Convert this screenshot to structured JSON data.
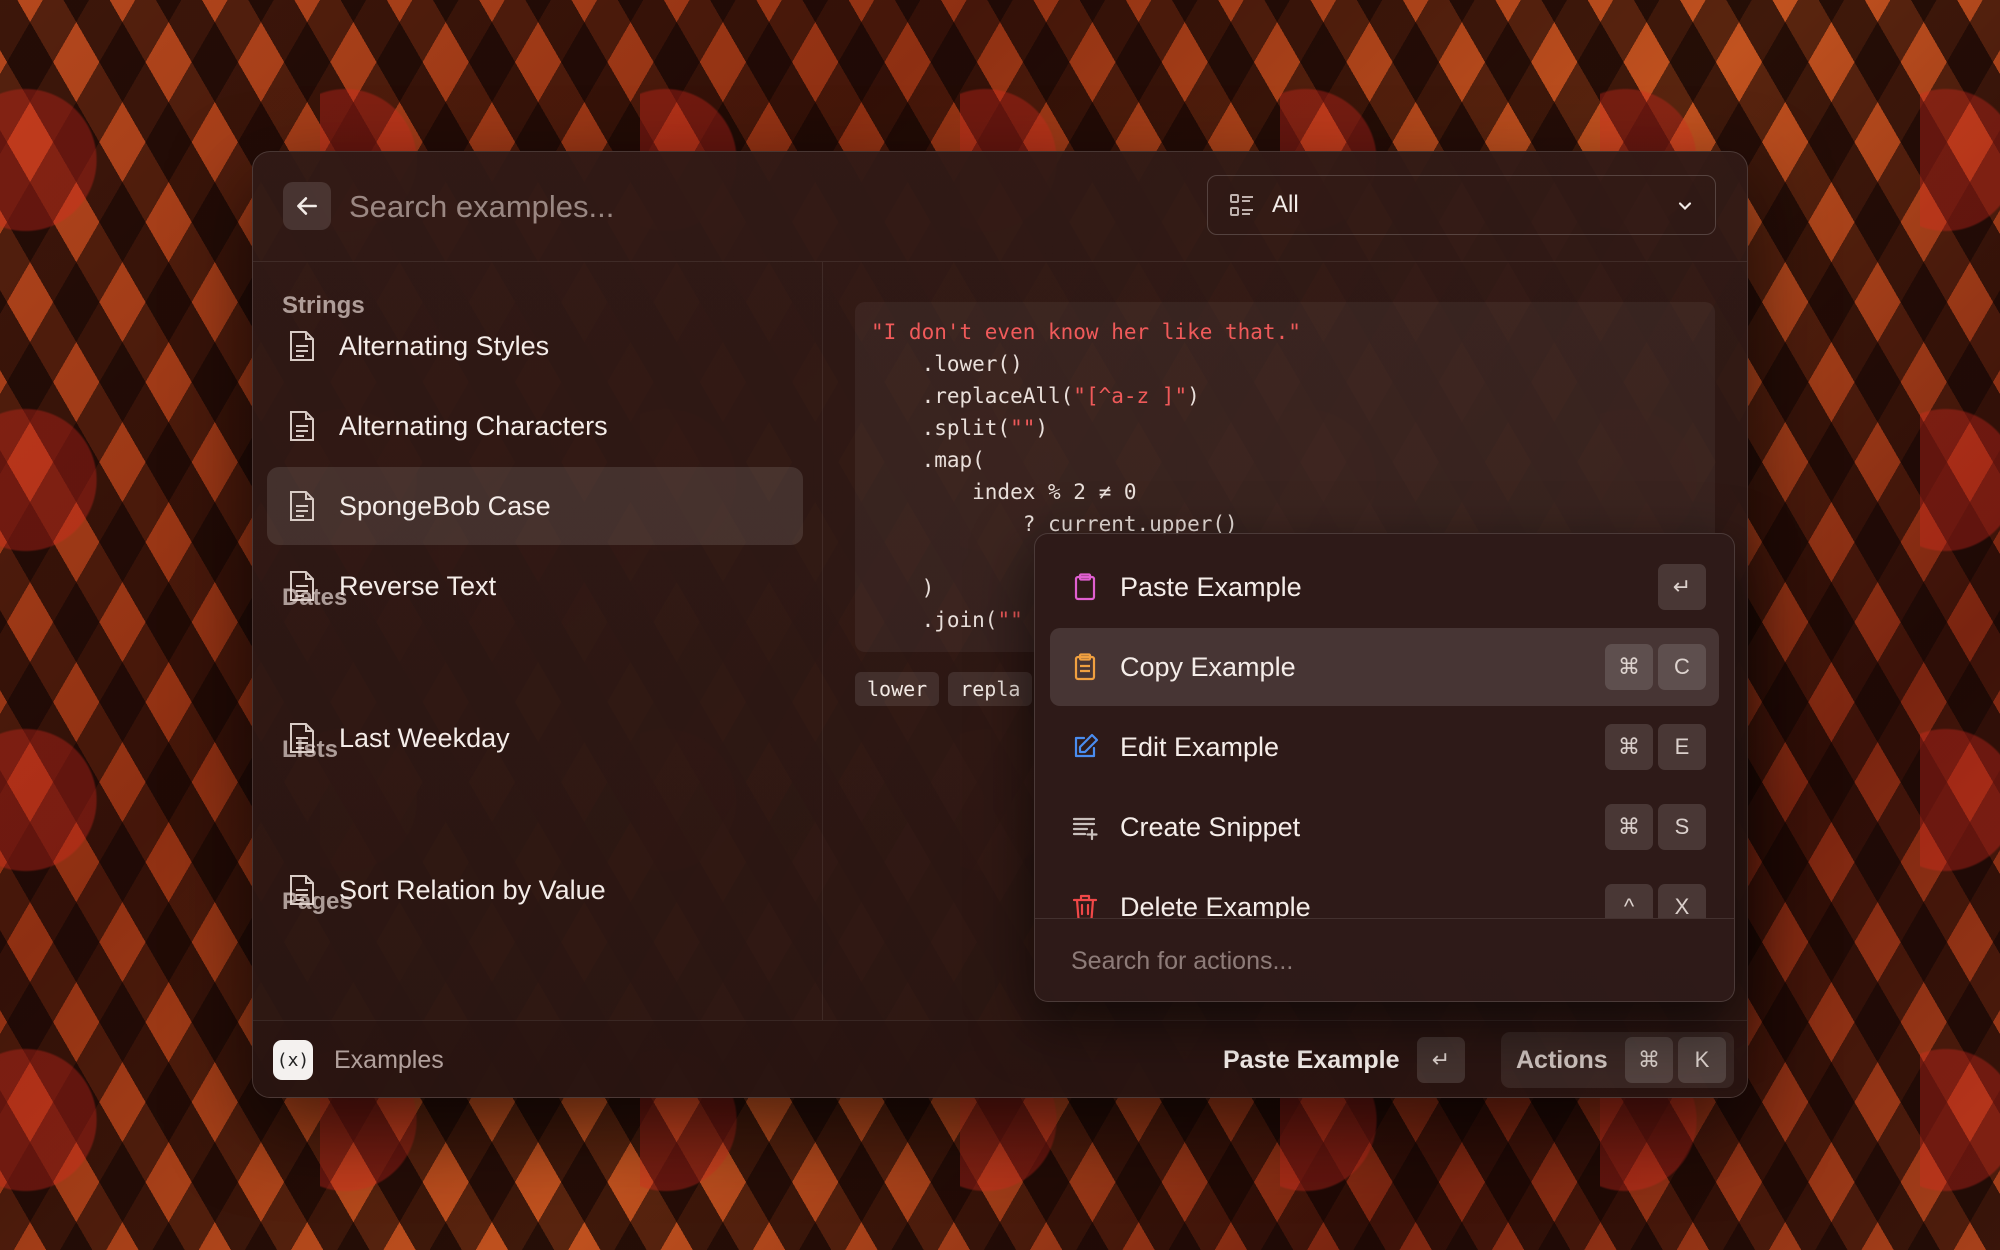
{
  "search": {
    "placeholder": "Search examples..."
  },
  "filter": {
    "value": "All"
  },
  "sidebar": {
    "sections": [
      {
        "title": "Strings",
        "items": [
          "Alternating Styles",
          "Alternating Characters",
          "SpongeBob Case",
          "Reverse Text"
        ]
      },
      {
        "title": "Dates",
        "items": [
          "Last Weekday"
        ]
      },
      {
        "title": "Lists",
        "items": [
          "Sort Relation by Value"
        ]
      },
      {
        "title": "Pages",
        "items": []
      }
    ],
    "selected": "SpongeBob Case"
  },
  "code": {
    "line1": "\"I don't even know her like that.\"",
    "line2": "    .lower()",
    "line3a": "    .replaceAll(",
    "line3b": "\"[^a-z ]\"",
    "line3c": ")",
    "line4a": "    .split(",
    "line4b": "\"\"",
    "line4c": ")",
    "line5": "    .map(",
    "line6": "        index % 2 ≠ 0",
    "line7": "            ? current.upper()",
    "line8": "",
    "line9": "    )",
    "line10a": "    .join(",
    "line10b": "\"\""
  },
  "tags": [
    "lower",
    "repla"
  ],
  "actions_menu": {
    "items": [
      {
        "label": "Paste Example",
        "keys": [
          "↵"
        ],
        "icon": "clipboard-icon",
        "color": "#e05fd0"
      },
      {
        "label": "Copy Example",
        "keys": [
          "⌘",
          "C"
        ],
        "icon": "clipboard-list-icon",
        "color": "#f0a040"
      },
      {
        "label": "Edit Example",
        "keys": [
          "⌘",
          "E"
        ],
        "icon": "pencil-icon",
        "color": "#4a8df0"
      },
      {
        "label": "Create Snippet",
        "keys": [
          "⌘",
          "S"
        ],
        "icon": "snippet-plus-icon",
        "color": "#c9c0bc"
      },
      {
        "label": "Delete Example",
        "keys": [
          "^",
          "X"
        ],
        "icon": "trash-icon",
        "color": "#f04848"
      }
    ],
    "search_placeholder": "Search for actions..."
  },
  "footer": {
    "app_icon": "(x)",
    "app_name": "Examples",
    "primary_action": "Paste Example",
    "primary_key": "↵",
    "actions_label": "Actions",
    "actions_keys": [
      "⌘",
      "K"
    ]
  }
}
